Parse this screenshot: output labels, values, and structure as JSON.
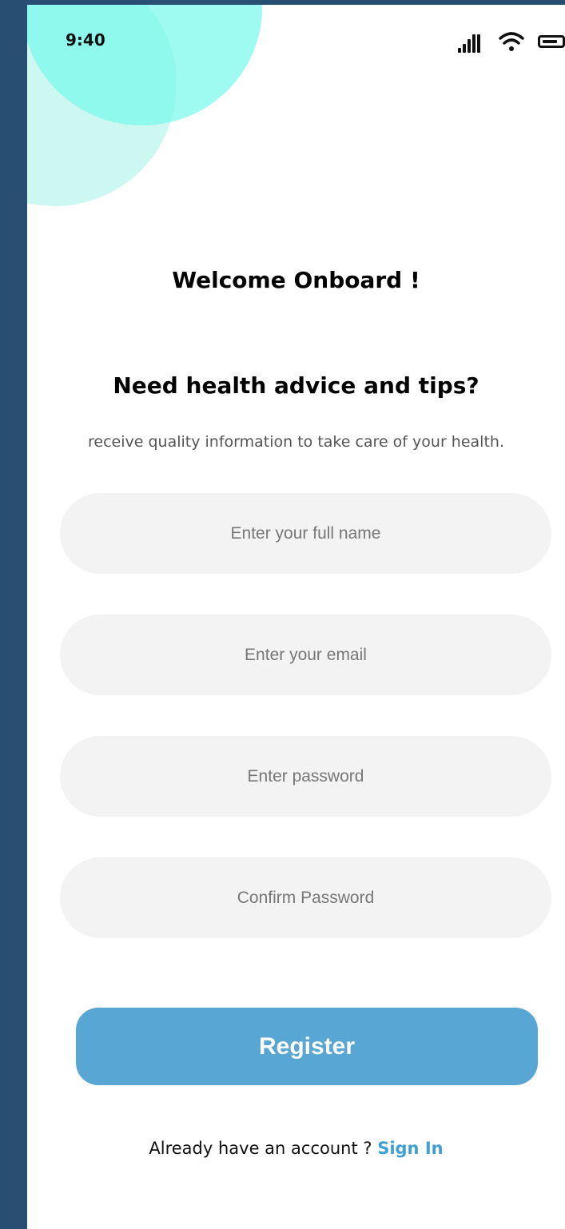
{
  "status_bar": {
    "time": "9:40",
    "icons": [
      "signal-icon",
      "wifi-icon",
      "battery-icon"
    ]
  },
  "header": {
    "welcome": "Welcome Onboard !",
    "title": "Need health advice and tips?",
    "subtitle": "receive quality information to take care of your health."
  },
  "form": {
    "full_name_placeholder": "Enter your full name",
    "email_placeholder": "Enter your email",
    "password_placeholder": "Enter password",
    "confirm_placeholder": "Confirm Password",
    "register_label": "Register"
  },
  "footer": {
    "prompt": "Already have an account ? ",
    "signin_label": "Sign In"
  },
  "colors": {
    "frame": "#284f72",
    "accent_blue": "#57a6d3",
    "link_blue": "#3f9fd7",
    "mint": "#78faec",
    "input_bg": "#f3f3f3"
  }
}
